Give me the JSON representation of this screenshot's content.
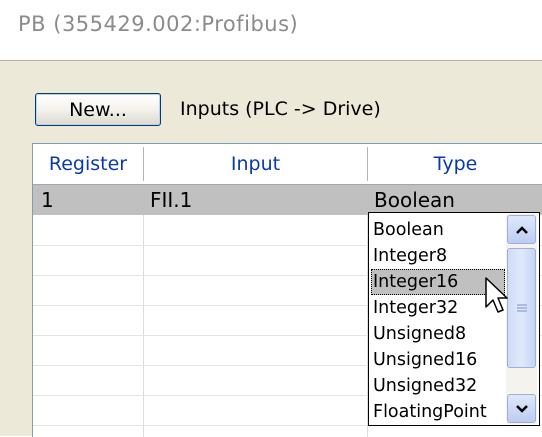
{
  "title": "PB (355429.002:Profibus)",
  "toolbar": {
    "new_label": "New...",
    "section_label": "Inputs (PLC -> Drive)"
  },
  "table": {
    "headers": {
      "register": "Register",
      "input": "Input",
      "type": "Type"
    },
    "rows": [
      {
        "register": "1",
        "input": "FII.1",
        "type": "Boolean"
      }
    ]
  },
  "type_dropdown": {
    "options": [
      "Boolean",
      "Integer8",
      "Integer16",
      "Integer32",
      "Unsigned8",
      "Unsigned16",
      "Unsigned32",
      "FloatingPoint"
    ],
    "highlighted": "Integer16"
  },
  "icons": [
    "arrow-cursor-icon",
    "scroll-up-icon",
    "scroll-down-icon",
    "scrollbar-grip-icon"
  ]
}
